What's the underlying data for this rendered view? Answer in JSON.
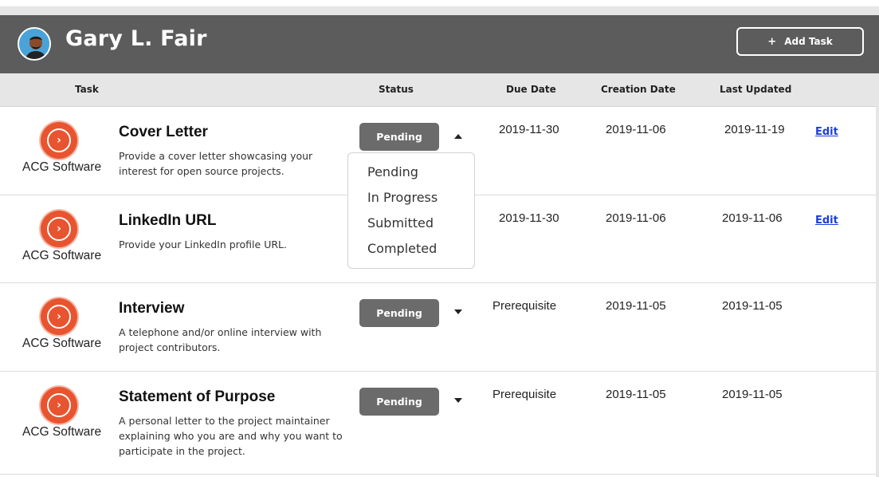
{
  "header": {
    "title": "Gary L. Fair",
    "add_task_icon": "+",
    "add_task_label": "Add Task",
    "avatar_icon": "user-avatar"
  },
  "columns": {
    "task": "Task",
    "status": "Status",
    "due_date": "Due Date",
    "creation_date": "Creation Date",
    "last_updated": "Last Updated"
  },
  "tasks": [
    {
      "company": "ACG Software",
      "title": "Cover Letter",
      "description": "Provide a cover letter showcasing your interest for open source projects.",
      "status": "Pending",
      "due_date": "2019-11-30",
      "creation_date": "2019-11-06",
      "last_updated": "2019-11-19",
      "edit_label": "Edit",
      "caret": "up"
    },
    {
      "company": "ACG Software",
      "title": "LinkedIn URL",
      "description": "Provide your LinkedIn profile URL.",
      "status": "",
      "due_date": "2019-11-30",
      "creation_date": "2019-11-06",
      "last_updated": "2019-11-06",
      "edit_label": "Edit"
    },
    {
      "company": "ACG Software",
      "title": "Interview",
      "description": "A telephone and/or online interview with project contributors.",
      "status": "Pending",
      "due_date": "Prerequisite",
      "creation_date": "2019-11-05",
      "last_updated": "2019-11-05",
      "caret": "down"
    },
    {
      "company": "ACG Software",
      "title": "Statement of Purpose",
      "description": "A personal letter to the project maintainer explaining who you are and why you want to participate in the project.",
      "status": "Pending",
      "due_date": "Prerequisite",
      "creation_date": "2019-11-05",
      "last_updated": "2019-11-05",
      "caret": "down"
    }
  ],
  "status_dropdown": {
    "options": [
      "Pending",
      "In Progress",
      "Submitted",
      "Completed"
    ]
  },
  "colors": {
    "header_bg": "#5c5c5c",
    "logo": "#e8542f",
    "status_button": "#6b6b6b",
    "edit_link": "#1a3fd6"
  }
}
